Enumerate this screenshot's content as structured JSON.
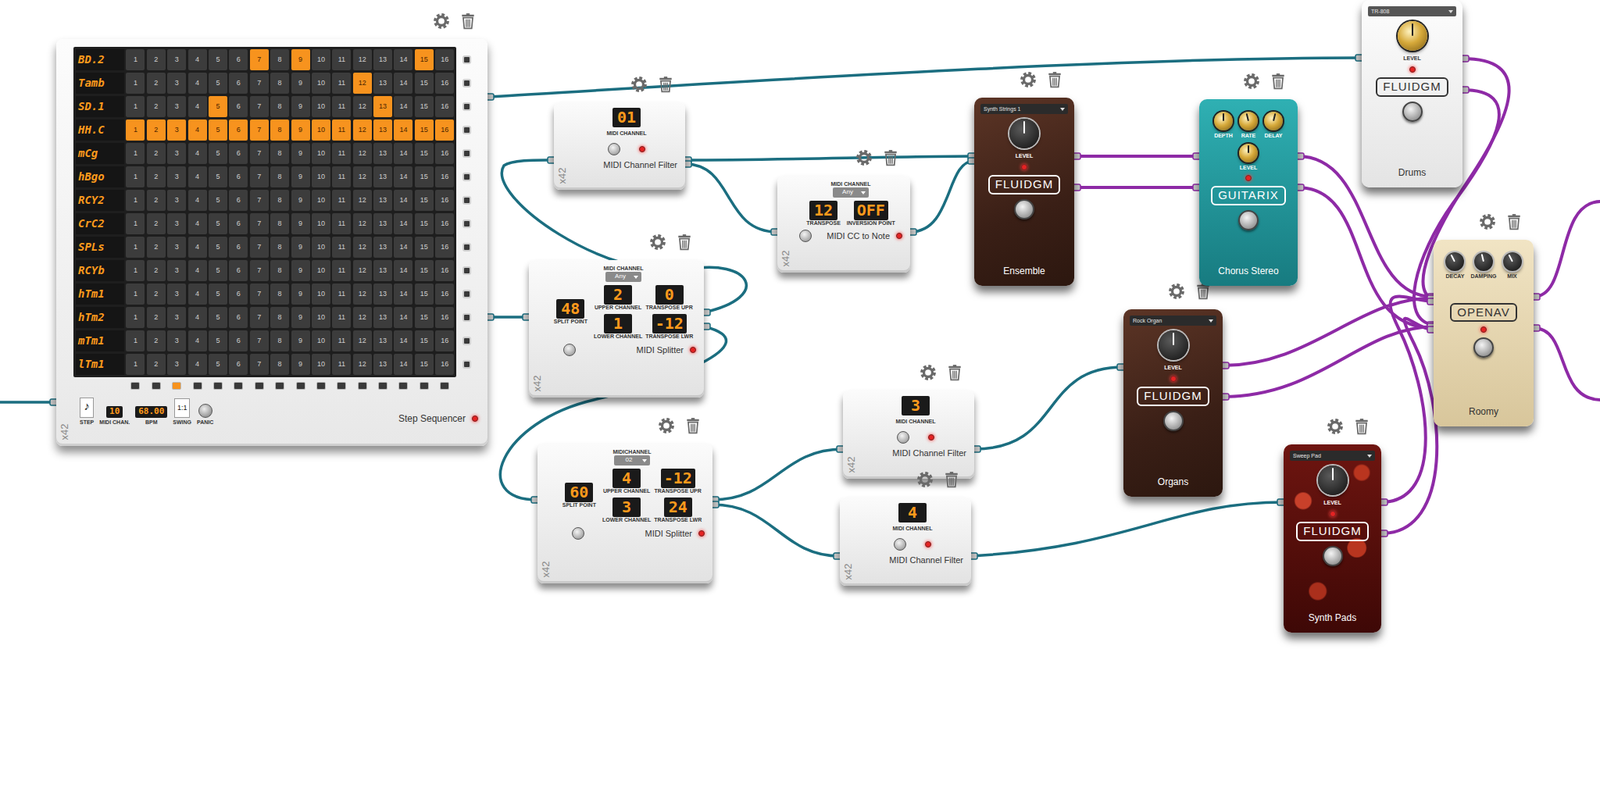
{
  "sequencer": {
    "title": "Step Sequencer",
    "brand": "x42",
    "active": true,
    "step_numbers": [
      "1",
      "2",
      "3",
      "4",
      "5",
      "6",
      "7",
      "8",
      "9",
      "10",
      "11",
      "12",
      "13",
      "14",
      "15",
      "16"
    ],
    "rows": [
      {
        "name": "BD.2",
        "steps": [
          false,
          false,
          false,
          false,
          false,
          false,
          true,
          false,
          true,
          false,
          false,
          false,
          false,
          false,
          true,
          false
        ]
      },
      {
        "name": "Tamb",
        "steps": [
          false,
          false,
          false,
          false,
          false,
          false,
          false,
          false,
          false,
          false,
          false,
          true,
          false,
          false,
          false,
          false
        ]
      },
      {
        "name": "SD.1",
        "steps": [
          false,
          false,
          false,
          false,
          true,
          false,
          false,
          false,
          false,
          false,
          false,
          false,
          true,
          false,
          false,
          false
        ]
      },
      {
        "name": "HH.C",
        "steps": [
          true,
          true,
          true,
          true,
          true,
          true,
          true,
          true,
          true,
          true,
          true,
          true,
          true,
          true,
          true,
          true
        ]
      },
      {
        "name": "mCg",
        "steps": [
          false,
          false,
          false,
          false,
          false,
          false,
          false,
          false,
          false,
          false,
          false,
          false,
          false,
          false,
          false,
          false
        ]
      },
      {
        "name": "hBgo",
        "steps": [
          false,
          false,
          false,
          false,
          false,
          false,
          false,
          false,
          false,
          false,
          false,
          false,
          false,
          false,
          false,
          false
        ]
      },
      {
        "name": "RCY2",
        "steps": [
          false,
          false,
          false,
          false,
          false,
          false,
          false,
          false,
          false,
          false,
          false,
          false,
          false,
          false,
          false,
          false
        ]
      },
      {
        "name": "CrC2",
        "steps": [
          false,
          false,
          false,
          false,
          false,
          false,
          false,
          false,
          false,
          false,
          false,
          false,
          false,
          false,
          false,
          false
        ]
      },
      {
        "name": "SPLs",
        "steps": [
          false,
          false,
          false,
          false,
          false,
          false,
          false,
          false,
          false,
          false,
          false,
          false,
          false,
          false,
          false,
          false
        ]
      },
      {
        "name": "RCYb",
        "steps": [
          false,
          false,
          false,
          false,
          false,
          false,
          false,
          false,
          false,
          false,
          false,
          false,
          false,
          false,
          false,
          false
        ]
      },
      {
        "name": "hTm1",
        "steps": [
          false,
          false,
          false,
          false,
          false,
          false,
          false,
          false,
          false,
          false,
          false,
          false,
          false,
          false,
          false,
          false
        ]
      },
      {
        "name": "hTm2",
        "steps": [
          false,
          false,
          false,
          false,
          false,
          false,
          false,
          false,
          false,
          false,
          false,
          false,
          false,
          false,
          false,
          false
        ]
      },
      {
        "name": "mTm1",
        "steps": [
          false,
          false,
          false,
          false,
          false,
          false,
          false,
          false,
          false,
          false,
          false,
          false,
          false,
          false,
          false,
          false
        ]
      },
      {
        "name": "lTm1",
        "steps": [
          false,
          false,
          false,
          false,
          false,
          false,
          false,
          false,
          false,
          false,
          false,
          false,
          false,
          false,
          false,
          false
        ]
      }
    ],
    "playhead": [
      false,
      false,
      true,
      false,
      false,
      false,
      false,
      false,
      false,
      false,
      false,
      false,
      false,
      false,
      false,
      false
    ],
    "footer": {
      "step_icon": "♪",
      "step_label": "STEP",
      "midi_channel": "10",
      "midi_label": "MIDI CHAN.",
      "bpm": "68.00",
      "bpm_label": "BPM",
      "swing": "1:1",
      "swing_label": "SWING",
      "panic_label": "PANIC"
    }
  },
  "channel_filters": [
    {
      "brand": "x42",
      "channel_label": "MIDI CHANNEL",
      "channel": "01",
      "title": "MIDI Channel Filter",
      "active": true
    },
    {
      "brand": "x42",
      "channel_label": "MIDI CHANNEL",
      "channel": "3",
      "title": "MIDI Channel Filter",
      "active": true
    },
    {
      "brand": "x42",
      "channel_label": "MIDI CHANNEL",
      "channel": "4",
      "title": "MIDI Channel Filter",
      "active": true
    }
  ],
  "cc_to_note": {
    "brand": "x42",
    "channel_label": "MIDI CHANNEL",
    "channel": "Any",
    "transpose": "12",
    "transpose_label": "TRANSPOSE",
    "inversion": "OFF",
    "inversion_label": "INVERSION POINT",
    "title": "MIDI CC to Note",
    "active": true
  },
  "splitters": [
    {
      "brand": "x42",
      "channel_label": "MIDI CHANNEL",
      "channel": "Any",
      "split": "48",
      "split_label": "SPLIT POINT",
      "upper_channel": "2",
      "upper_channel_label": "UPPER CHANNEL",
      "transpose_upper": "0",
      "transpose_upper_label": "TRANSPOSE UPR",
      "lower_channel": "1",
      "lower_channel_label": "LOWER CHANNEL",
      "transpose_lower": "-12",
      "transpose_lower_label": "TRANSPOSE LWR",
      "title": "MIDI Splitter",
      "active": true
    },
    {
      "brand": "x42",
      "channel_label": "MIDICHANNEL",
      "channel": "02",
      "split": "60",
      "split_label": "SPLIT POINT",
      "upper_channel": "4",
      "upper_channel_label": "UPPER CHANNEL",
      "transpose_upper": "-12",
      "transpose_upper_label": "TRANSPOSE UPR",
      "lower_channel": "3",
      "lower_channel_label": "LOWER CHANNEL",
      "transpose_lower": "24",
      "transpose_lower_label": "TRANSPOSE LWR",
      "title": "MIDI Splitter",
      "active": true
    }
  ],
  "instruments": [
    {
      "kind": "wood",
      "preset": "Synth Strings 1",
      "level_label": "LEVEL",
      "level": 0.5,
      "brand": "FLUIDGM",
      "title": "Ensemble",
      "active": true
    },
    {
      "kind": "white",
      "preset": "TR-808",
      "level_label": "LEVEL",
      "level": 0.5,
      "brand": "FLUIDGM",
      "title": "Drums",
      "active": true
    },
    {
      "kind": "wood",
      "preset": "Rock Organ",
      "level_label": "LEVEL",
      "level": 0.5,
      "brand": "FLUIDGM",
      "title": "Organs",
      "active": true
    },
    {
      "kind": "lava",
      "preset": "Sweep Pad",
      "level_label": "LEVEL",
      "level": 0.5,
      "brand": "FLUIDGM",
      "title": "Synth Pads",
      "active": true
    }
  ],
  "chorus": {
    "brand": "GUITARIX",
    "title": "Chorus Stereo",
    "active": true,
    "knobs": [
      {
        "label": "DEPTH",
        "level": 0.5
      },
      {
        "label": "RATE",
        "level": 0.45
      },
      {
        "label": "DELAY",
        "level": 0.55
      }
    ],
    "level_label": "LEVEL",
    "level": 0.5
  },
  "reverb": {
    "brand": "OPENAV",
    "title": "Roomy",
    "active": true,
    "knobs": [
      {
        "label": "DECAY",
        "level": 0.4
      },
      {
        "label": "DAMPING",
        "level": 0.45
      },
      {
        "label": "MIX",
        "level": 0.4
      }
    ]
  }
}
